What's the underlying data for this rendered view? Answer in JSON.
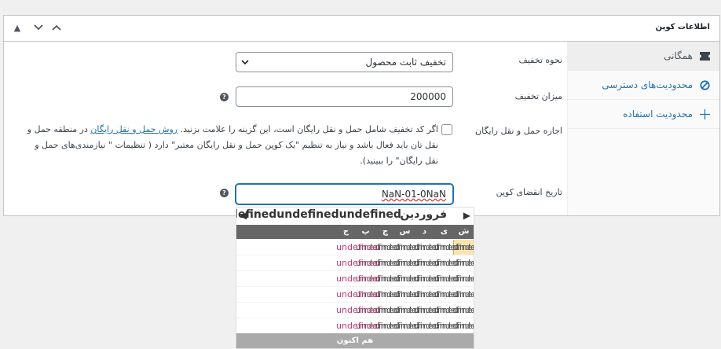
{
  "panel": {
    "title": "اطلاعات کوپن",
    "controls": {
      "up": "▲",
      "down": "▼",
      "collapse": "▲"
    }
  },
  "tabs": [
    {
      "label": "همگانی",
      "icon": "ticket-icon",
      "active": true
    },
    {
      "label": "محدودیت‌های دسترسی",
      "icon": "blocked-icon",
      "active": false
    },
    {
      "label": "محدودیت استفاده",
      "icon": "crosshair-icon",
      "active": false
    }
  ],
  "fields": {
    "discount_type": {
      "label": "نحوه تخفیف",
      "value": "تخفیف ثابت محصول"
    },
    "amount": {
      "label": "میزان تخفیف",
      "value": "200000"
    },
    "free_shipping": {
      "label": "اجازه حمل و نقل رایگان",
      "checked": false,
      "desc_before": "اگر کد تخفیف شامل حمل و نقل رایگان است، این گزینه را علامت بزنید. ",
      "desc_link": "روش حمل و نقل رایگان",
      "desc_after": " در منطقه حمل و نقل تان باید فعال باشد و نیاز به تنظیم \"یک کوپن حمل و نقل رایگان معتبر\" دارد ( تنظیمات \" نیازمندی‌های حمل و نقل رایگان\" را ببینید)."
    },
    "expiry": {
      "label": "تاریخ انقضای کوپن",
      "value": "NaN-01-0NaN"
    }
  },
  "datepicker": {
    "month": "فروردین",
    "year": "undefinedundefinedundefined",
    "prev": "◀",
    "next": "▶",
    "weekdays": [
      "ش",
      "ی",
      "د",
      "س",
      "چ",
      "پ",
      "ج"
    ],
    "cell_text": "undefined",
    "rows": 6,
    "today_button": "هم اکنون"
  },
  "colors": {
    "accent": "#2271b1",
    "header_bg": "#666666"
  }
}
